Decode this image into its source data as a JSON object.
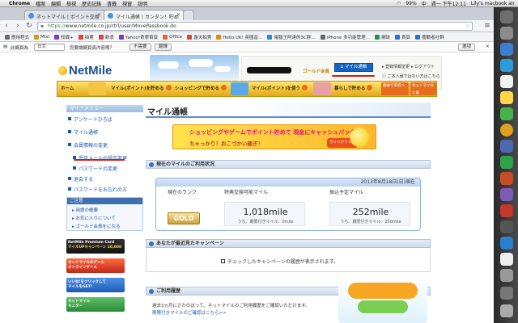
{
  "menubar": {
    "apple": "",
    "app": "Chrome",
    "items": [
      "檔案",
      "編輯",
      "檢視",
      "歷史記錄",
      "書籤",
      "視窗",
      "說明"
    ],
    "battery": "99%",
    "lang": "中",
    "clock": "週一 下午12:11",
    "user": "Lily's macbook air"
  },
  "tabs": [
    {
      "title": "ネットマイル | ポイント交換",
      "active": false
    },
    {
      "title": "マイル通帳 | カンタン！貯め",
      "active": true
    }
  ],
  "toolbar": {
    "scheme": "https://",
    "url": "www.netmile.co.jp/ctrl/user/MovePassbook.do"
  },
  "bookmarks": [
    {
      "label": "應用程式",
      "color": "#6b6b6b"
    },
    {
      "label": "Mixi",
      "color": "#c99a2e"
    },
    {
      "label": "知識+",
      "color": "#7d3fb5"
    },
    {
      "label": "拍賣",
      "color": "#d64545"
    },
    {
      "label": "新浪",
      "color": "#d64545"
    },
    {
      "label": "Yahoo!奇摩首頁",
      "color": "#7d3fb5"
    },
    {
      "label": "Office",
      "color": "#e0692f"
    },
    {
      "label": "露天拍賣",
      "color": "#d64545"
    },
    {
      "label": "Hello UK! 英國音…",
      "color": "#d68b2e"
    },
    {
      "label": "電腦王阿達的3C胖…",
      "color": "#2e86d6"
    },
    {
      "label": "iPhone 多功能管理…",
      "color": "#666"
    },
    {
      "label": "網誌",
      "color": "#2e8b57"
    },
    {
      "label": "首頁",
      "color": "#2e6fd6"
    },
    {
      "label": "體驗者社群",
      "color": "#2e6fd6"
    }
  ],
  "translate_bar": {
    "label": "此網頁為",
    "lang": "日文",
    "question": "您要讓網頁真內容嗎？",
    "no": "不需要",
    "yes": "翻譯",
    "options": "選項"
  },
  "site": {
    "logo": "NetMile",
    "rank_label": "ゴールド会員",
    "my_page": "マイル通帳",
    "link_register": "登録情報変更",
    "link_logout": "ログアウト",
    "link_delete": "ご本人様ではない方はこちら",
    "nav": [
      "ホーム",
      "マイル(ポイント)を貯める",
      "ショッピングで貯める",
      "マイル(ポイント)を使う",
      "暮らしで貯める",
      "初めての方へ",
      "ネットマイルとは"
    ]
  },
  "sidebar": {
    "heading": "マイ・メニュー",
    "links": [
      "アンケートひろば",
      "マイル通帳",
      "会員情報の変更",
      "受信メールの設定変更",
      "パスワードの変更",
      "退会する",
      "パスワードをお忘れの方"
    ],
    "guide": {
      "heading": "ご注意",
      "links": [
        "用語の概要",
        "お気に入りについて",
        "ゴールド会員をになる"
      ]
    },
    "banners": [
      {
        "text": "NetMile Premium Card",
        "sub": "マイルUPキャンペーン 10,000",
        "color": "#1b1b1b"
      },
      {
        "text": "ネットマイルのゲーム",
        "sub": "オンラインゲーム",
        "color": "#d63a2f"
      },
      {
        "text": "いいね!をクリックして",
        "sub": "マイルをGET!",
        "color": "#2e6fd6"
      },
      {
        "text": "ネットマイル",
        "sub": "モニター",
        "color": "#39a845"
      }
    ]
  },
  "main": {
    "title": "マイル通帳",
    "promo_line1": "ショッピングやゲームでポイント貯めて 現金にキャッシュバック！",
    "promo_line2": "ちゃっかり！おこづかい稼ぎ！",
    "promo_tag": "ちゃっかりッチ",
    "status_heading": "現在のマイルのご利用状況",
    "date": "2013年8月18日(日)現在",
    "rank_label": "現在のランク",
    "rank_value": "GOLD",
    "tradeable_label": "特典交換可能マイル",
    "tradeable_value": "1,018mile",
    "tradeable_sub": "うち、期限付きマイル：0mile",
    "pending_label": "振込予定マイル",
    "pending_value": "252mile",
    "pending_sub": "うち、期限付きマイル：250mile",
    "campaign_heading": "あなたが最近見たキャンペーン",
    "campaign_text": "チェックしたキャンペーンの履歴が表示されます。",
    "history_heading": "ご利用履歴",
    "history_text": "過去3ヵ月にさかのぼって、ネットマイルのご利用履歴をご確認いただけます。",
    "history_link": "期限付きマイルのご確認はこちら>>"
  }
}
